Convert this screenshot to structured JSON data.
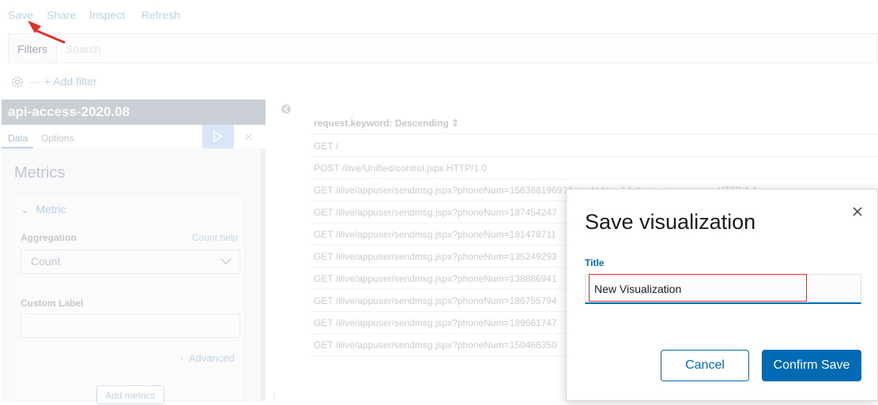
{
  "topnav": {
    "save": "Save",
    "share": "Share",
    "inspect": "Inspect",
    "refresh": "Refresh"
  },
  "filterbar": {
    "label": "Filters",
    "search_placeholder": "Search",
    "add_filter": "+ Add filter"
  },
  "panel": {
    "index_title": "api-access-2020.08",
    "tabs": [
      "Data",
      "Options"
    ],
    "metrics_title": "Metrics",
    "metric_label": "Metric",
    "aggregation_label": "Aggregation",
    "count_help": "Count help",
    "aggregation_value": "Count",
    "custom_label": "Custom Label",
    "custom_label_value": "",
    "advanced": "Advanced",
    "add_metrics": "Add metrics"
  },
  "table": {
    "header": "request.keyword: Descending ⇕",
    "rows": [
      "GET /",
      "POST /ilive/Unified/control.jspx HTTP/1.0",
      "GET /ilive/appuser/sendmsg.jspx?phoneNum=1563881969?&smsIndex=&&stamp=javaexpress HTTP/1.1",
      "GET /ilive/appuser/sendmsg.jspx?phoneNum=187454247",
      "GET /ilive/appuser/sendmsg.jspx?phoneNum=181478711",
      "GET /ilive/appuser/sendmsg.jspx?phoneNum=135249293",
      "GET /ilive/appuser/sendmsg.jspx?phoneNum=138886941",
      "GET /ilive/appuser/sendmsg.jspx?phoneNum=186755794",
      "GET /ilive/appuser/sendmsg.jspx?phoneNum=189661747",
      "GET /ilive/appuser/sendmsg.jspx?phoneNum=150466350"
    ]
  },
  "modal": {
    "title": "Save visualization",
    "field_label": "Title",
    "field_value": "New Visualization",
    "cancel": "Cancel",
    "confirm": "Confirm Save"
  },
  "colors": {
    "accent": "#006bb4",
    "annotation": "#e0332a"
  }
}
